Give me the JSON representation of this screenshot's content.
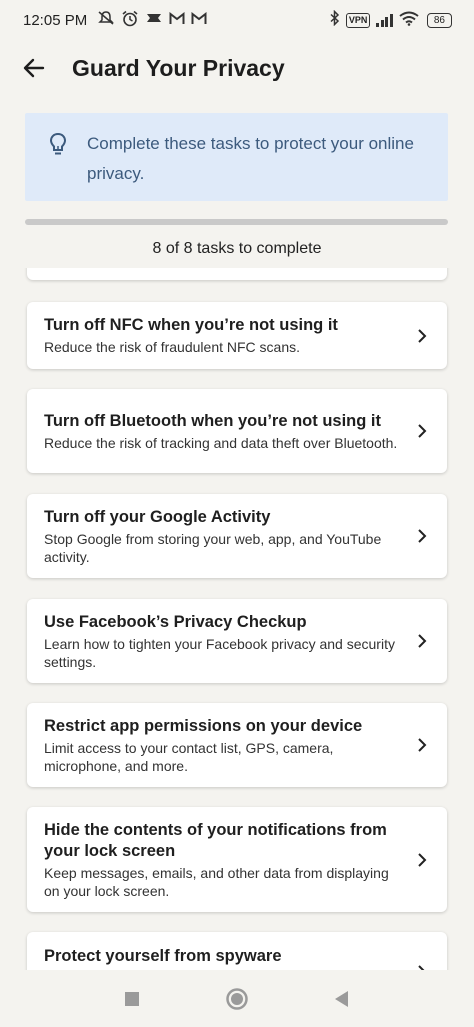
{
  "status_bar": {
    "time": "12:05 PM",
    "vpn": "VPN",
    "battery": "86",
    "icons": [
      "no-notifications-icon",
      "alarm-icon",
      "app-icon",
      "gmail-icon",
      "gmail-icon",
      "bluetooth-icon",
      "vpn-icon",
      "signal-icon",
      "wifi-icon",
      "battery-icon"
    ]
  },
  "header": {
    "back_icon": "back-arrow-icon",
    "title": "Guard Your Privacy"
  },
  "banner": {
    "icon": "lightbulb-icon",
    "text": "Complete these tasks to protect your online privacy."
  },
  "progress": {
    "label": "8 of 8 tasks to complete",
    "completed_fraction": 0.0
  },
  "tasks": [
    {
      "title": "Turn off NFC when you’re not using it",
      "desc": "Reduce the risk of fraudulent NFC scans."
    },
    {
      "title": "Turn off Bluetooth when you’re not using it",
      "desc": "Reduce the risk of tracking and data theft over Bluetooth."
    },
    {
      "title": "Turn off your Google Activity",
      "desc": "Stop Google from storing your web, app, and YouTube activity."
    },
    {
      "title": "Use Facebook’s Privacy Checkup",
      "desc": "Learn how to tighten your Facebook privacy and security settings."
    },
    {
      "title": "Restrict app permissions on your device",
      "desc": "Limit access to your contact list, GPS, camera, microphone, and more."
    },
    {
      "title": "Hide the contents of your notifications from your lock screen",
      "desc": "Keep messages, emails, and other data from displaying on your lock screen."
    },
    {
      "title": "Protect yourself from spyware",
      "desc": ""
    }
  ],
  "nav": {
    "icons": [
      "recents-square-icon",
      "home-circle-icon",
      "back-triangle-icon"
    ]
  },
  "colors": {
    "background": "#f4f3ef",
    "banner_bg": "#dfeaf9",
    "banner_text": "#3c5a7d",
    "card_bg": "#ffffff"
  }
}
